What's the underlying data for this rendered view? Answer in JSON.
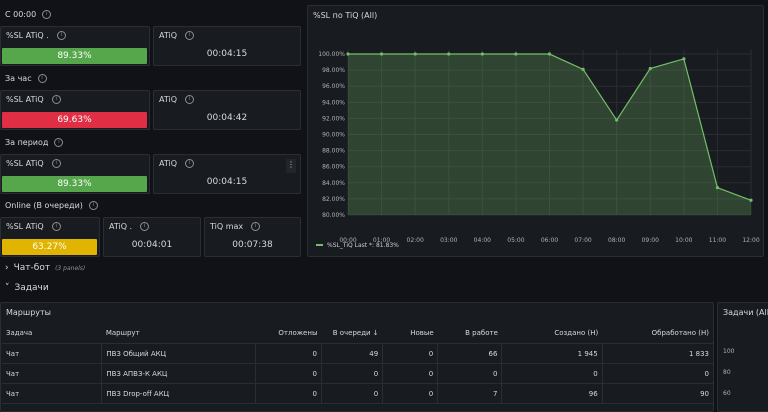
{
  "sections": {
    "since_midnight": "С 00:00",
    "last_hour": "За час",
    "period": "За период",
    "online": "Online (В очереди)"
  },
  "stats": {
    "r1": {
      "sl_label": "%SL ATiQ .",
      "sl_value": "89.33%",
      "sl_color": "#56a64b",
      "sl_fraction": 0.9933,
      "atiq_label": "ATiQ",
      "atiq_value": "00:04:15"
    },
    "r2": {
      "sl_label": "%SL ATiQ",
      "sl_value": "69.63%",
      "sl_color": "#e02f44",
      "sl_fraction": 0.9933,
      "atiq_label": "ATiQ",
      "atiq_value": "00:04:42"
    },
    "r3": {
      "sl_label": "%SL ATiQ",
      "sl_value": "89.33%",
      "sl_color": "#56a64b",
      "sl_fraction": 0.9933,
      "atiq_label": "ATiQ",
      "atiq_value": "00:04:15",
      "menu": "⋮"
    },
    "r4": {
      "sl_label": "%SL ATiQ",
      "sl_value": "63.27%",
      "sl_color": "#e0b400",
      "sl_fraction": 0.9933,
      "atiq_label": "ATiQ .",
      "atiq_value": "00:04:01",
      "tiqmax_label": "TiQ max",
      "tiqmax_value": "00:07:38"
    }
  },
  "chart_panel": {
    "title": "%SL по TiQ (All)"
  },
  "chart_data": {
    "type": "area",
    "title": "%SL по TiQ (All)",
    "x": [
      "00:00",
      "01:00",
      "02:00",
      "03:00",
      "04:00",
      "05:00",
      "06:00",
      "07:00",
      "08:00",
      "09:00",
      "10:00",
      "11:00",
      "12:00"
    ],
    "yticks": [
      "100.00%",
      "98.00%",
      "96.00%",
      "94.00%",
      "92.00%",
      "90.00%",
      "88.00%",
      "86.00%",
      "84.00%",
      "82.00%",
      "80.00%"
    ],
    "ylim": [
      80,
      100.5
    ],
    "series": [
      {
        "name": "%SL_TiQ",
        "values": [
          100,
          100,
          100,
          100,
          100,
          100,
          100,
          98.1,
          91.8,
          98.2,
          99.4,
          83.4,
          81.83
        ],
        "color": "#73bf69"
      }
    ],
    "legend": "%SL_TiQ   Last *: 81.83%",
    "legend_position": "bottom-left",
    "grid": true
  },
  "rows": {
    "chatbot": {
      "label": "Чат-бот",
      "hint": "(3 panels)",
      "chevron": "›"
    },
    "tasks": {
      "label": "Задачи",
      "chevron": "˅"
    }
  },
  "routes_panel": {
    "title": "Маршруты",
    "headers": [
      "Задача",
      "Маршрут",
      "Отложены",
      "В очереди ↓",
      "Новые",
      "В работе",
      "Создано (Н)",
      "Обработано (Н)"
    ],
    "rows": [
      [
        "Чат",
        "ПВЗ Общий АКЦ",
        "0",
        "49",
        "0",
        "66",
        "1 945",
        "1 833"
      ],
      [
        "Чат",
        "ПВЗ АПВЗ-К АКЦ",
        "0",
        "0",
        "0",
        "0",
        "0",
        "0"
      ],
      [
        "Чат",
        "ПВЗ Drop-off АКЦ",
        "0",
        "0",
        "0",
        "7",
        "96",
        "90"
      ]
    ]
  },
  "side_panel": {
    "title": "Задачи (All)",
    "yticks": [
      "100",
      "80",
      "60"
    ]
  }
}
